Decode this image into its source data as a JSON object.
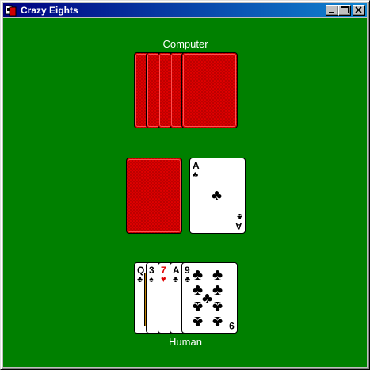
{
  "window": {
    "title": "Crazy Eights",
    "app_icon": "cards-app-icon",
    "controls": {
      "minimize": "minimize-icon",
      "maximize": "maximize-icon",
      "close": "close-icon"
    }
  },
  "table": {
    "background_color": "#008000",
    "card_back_color": "#e00000",
    "computer_label": "Computer",
    "human_label": "Human"
  },
  "computer_hand": {
    "card_count": 5,
    "face": "down"
  },
  "draw_pile": {
    "face": "down"
  },
  "discard_pile": {
    "top_card": {
      "rank": "A",
      "suit": "♣",
      "suit_name": "clubs",
      "color": "black"
    }
  },
  "human_hand": {
    "cards": [
      {
        "rank": "Q",
        "suit": "♣",
        "suit_name": "clubs",
        "color": "black"
      },
      {
        "rank": "3",
        "suit": "♠",
        "suit_name": "spades",
        "color": "black"
      },
      {
        "rank": "7",
        "suit": "♥",
        "suit_name": "hearts",
        "color": "red"
      },
      {
        "rank": "A",
        "suit": "♣",
        "suit_name": "clubs",
        "color": "black"
      },
      {
        "rank": "9",
        "suit": "♣",
        "suit_name": "clubs",
        "color": "black"
      }
    ]
  }
}
